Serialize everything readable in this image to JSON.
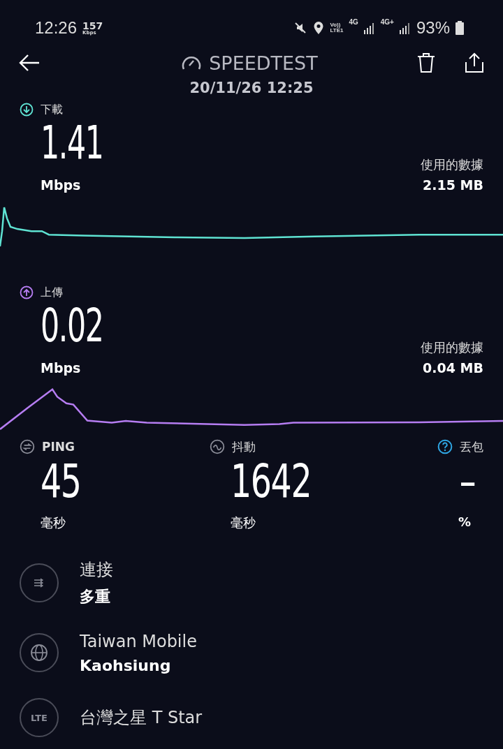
{
  "status_bar": {
    "time": "12:26",
    "speed_value": "157",
    "speed_unit": "Kbps",
    "volte_top": "Vo))",
    "volte_bottom": "LTE1",
    "network_1": "4G",
    "network_2": "4G+",
    "battery": "93%"
  },
  "header": {
    "title": "SPEEDTEST",
    "date": "20/11/26 12:25"
  },
  "metrics": [
    {
      "kind": "download",
      "label": "下載",
      "value": "1.41",
      "unit": "Mbps",
      "data_label": "使用的數據",
      "data_value": "2.15 MB",
      "color": "#5fe3d3"
    },
    {
      "kind": "upload",
      "label": "上傳",
      "value": "0.02",
      "unit": "Mbps",
      "data_label": "使用的數據",
      "data_value": "0.04 MB",
      "color": "#b67df2"
    }
  ],
  "stats": [
    {
      "kind": "ping",
      "label": "PING",
      "value": "45",
      "unit": "毫秒"
    },
    {
      "kind": "jitter",
      "label": "抖動",
      "value": "1642",
      "unit": "毫秒"
    },
    {
      "kind": "loss",
      "label": "丟包",
      "value": "–",
      "unit": "%"
    }
  ],
  "details": [
    {
      "kind": "connections",
      "title": "連接",
      "subtitle": "多重"
    },
    {
      "kind": "server",
      "title": "Taiwan Mobile",
      "subtitle": "Kaohsiung"
    },
    {
      "kind": "provider",
      "badge": "LTE",
      "title": "台灣之星 T Star"
    }
  ]
}
